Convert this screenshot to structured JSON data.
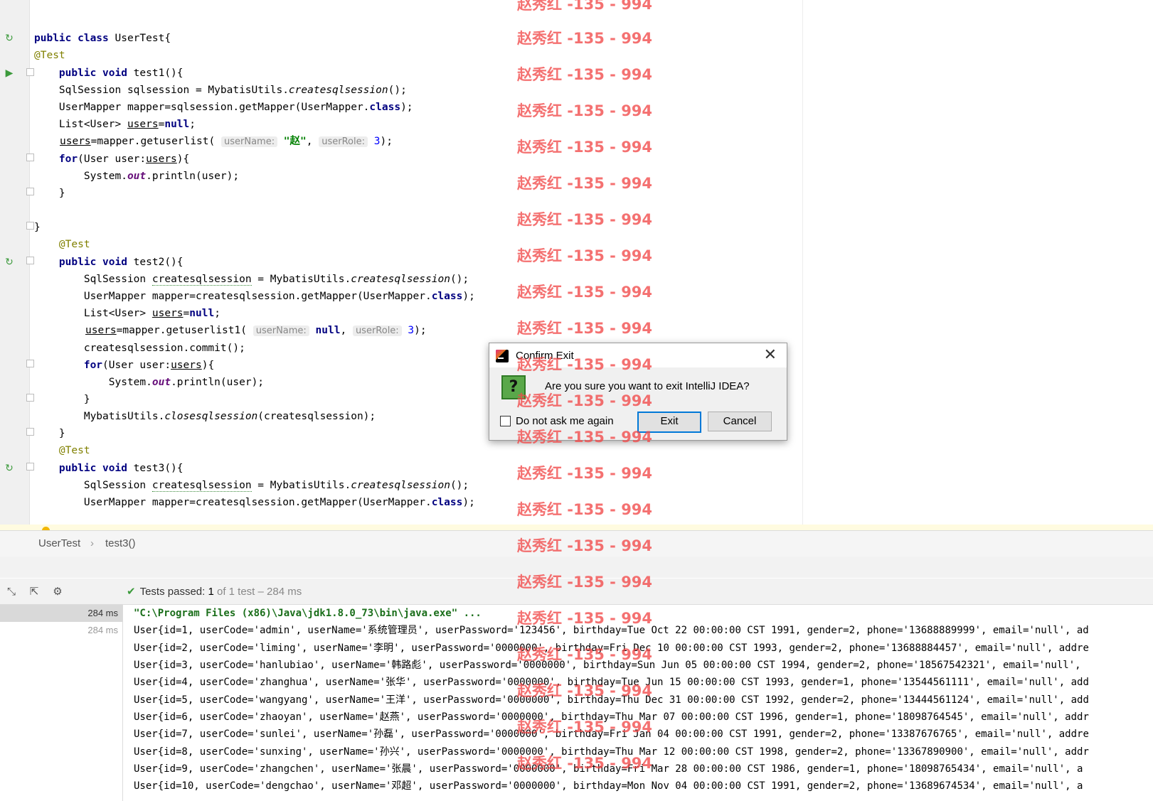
{
  "editor": {
    "lines": {
      "l1_a": "public class",
      "l1_b": " UserTest{",
      "l2": "@Test",
      "l3_a": "    public void",
      "l3_b": " test1(){",
      "l4_a": "    SqlSession sqlsession = MybatisUtils.",
      "l4_b": "createsqlsession",
      "l4_c": "();",
      "l5_a": "    UserMapper mapper=sqlsession.getMapper(UserMapper.",
      "l5_b": "class",
      "l5_c": ");",
      "l6_a": "    List<User> ",
      "l6_b": "users",
      "l6_c": "=",
      "l6_d": "null",
      "l6_e": ";",
      "l7_a": "users",
      "l7_b": "=mapper.getuserlist( ",
      "l7_hint1": "userName:",
      "l7_c": " \"赵\"",
      "l7_d": ", ",
      "l7_hint2": "userRole:",
      "l7_e": " 3",
      "l7_f": ");",
      "l8_a": "    for",
      "l8_b": "(User user:",
      "l8_c": "users",
      "l8_d": "){",
      "l9_a": "        System.",
      "l9_b": "out",
      "l9_c": ".println(user);",
      "l10": "    }",
      "l12": "}",
      "l13": "    @Test",
      "l14_a": "    public void",
      "l14_b": " test2(){",
      "l15_a": "        SqlSession ",
      "l15_b": "createsqlsession",
      "l15_c": " = MybatisUtils.",
      "l15_d": "createsqlsession",
      "l15_e": "();",
      "l16_a": "        UserMapper mapper=createsqlsession.getMapper(UserMapper.",
      "l16_b": "class",
      "l16_c": ");",
      "l17_a": "        List<User> ",
      "l17_b": "users",
      "l17_c": "=",
      "l17_d": "null",
      "l17_e": ";",
      "l18_a": "users",
      "l18_b": "=mapper.getuserlist1( ",
      "l18_hint1": "userName:",
      "l18_c": " null",
      "l18_d": ", ",
      "l18_hint2": "userRole:",
      "l18_e": " 3",
      "l18_f": ");",
      "l19": "        createsqlsession.commit();",
      "l20_a": "        for",
      "l20_b": "(User user:",
      "l20_c": "users",
      "l20_d": "){",
      "l21_a": "            System.",
      "l21_b": "out",
      "l21_c": ".println(user);",
      "l22": "        }",
      "l23_a": "        MybatisUtils.",
      "l23_b": "closesqlsession",
      "l23_c": "(createsqlsession);",
      "l24": "    }",
      "l25": "    @Test",
      "l26_a": "    public void",
      "l26_b": " test3(){",
      "l27_a": "        SqlSession ",
      "l27_b": "createsqlsession",
      "l27_c": " = MybatisUtils.",
      "l27_d": "createsqlsession",
      "l27_e": "();",
      "l28_a": "        UserMapper mapper=createsqlsession.getMapper(UserMapper.",
      "l28_b": "class",
      "l28_c": ");"
    }
  },
  "breadcrumb": {
    "items": [
      "UserTest",
      "test3()"
    ],
    "separator": "›"
  },
  "run_panel": {
    "status_prefix": "Tests passed:",
    "passed_count": "1",
    "status_suffix": "of 1 test – 284 ms",
    "tree": [
      {
        "time": "284 ms"
      },
      {
        "time": "284 ms"
      }
    ],
    "console": [
      "\"C:\\Program Files (x86)\\Java\\jdk1.8.0_73\\bin\\java.exe\" ...",
      "User{id=1, userCode='admin', userName='系统管理员', userPassword='123456', birthday=Tue Oct 22 00:00:00 CST 1991, gender=2, phone='13688889999', email='null', ad",
      "User{id=2, userCode='liming', userName='李明', userPassword='0000000', birthday=Fri Dec 10 00:00:00 CST 1993, gender=2, phone='13688884457', email='null', addre",
      "User{id=3, userCode='hanlubiao', userName='韩路彪', userPassword='0000000', birthday=Sun Jun 05 00:00:00 CST 1994, gender=2, phone='18567542321', email='null', ",
      "User{id=4, userCode='zhanghua', userName='张华', userPassword='0000000', birthday=Tue Jun 15 00:00:00 CST 1993, gender=1, phone='13544561111', email='null', add",
      "User{id=5, userCode='wangyang', userName='王洋', userPassword='0000000', birthday=Thu Dec 31 00:00:00 CST 1992, gender=2, phone='13444561124', email='null', add",
      "User{id=6, userCode='zhaoyan', userName='赵燕', userPassword='0000000', birthday=Thu Mar 07 00:00:00 CST 1996, gender=1, phone='18098764545', email='null', addr",
      "User{id=7, userCode='sunlei', userName='孙磊', userPassword='0000000', birthday=Fri Jan 04 00:00:00 CST 1991, gender=2, phone='13387676765', email='null', addre",
      "User{id=8, userCode='sunxing', userName='孙兴', userPassword='0000000', birthday=Thu Mar 12 00:00:00 CST 1998, gender=2, phone='13367890900', email='null', addr",
      "User{id=9, userCode='zhangchen', userName='张晨', userPassword='0000000', birthday=Fri Mar 28 00:00:00 CST 1986, gender=1, phone='18098765434', email='null', a",
      "User{id=10, userCode='dengchao', userName='邓超', userPassword='0000000', birthday=Mon Nov 04 00:00:00 CST 1991, gender=2, phone='13689674534', email='null', a"
    ]
  },
  "dialog": {
    "title": "Confirm Exit",
    "message": "Are you sure you want to exit IntelliJ IDEA?",
    "checkbox_label": "Do not ask me again",
    "exit_label": "Exit",
    "cancel_label": "Cancel",
    "icon": "question-icon"
  },
  "watermark": {
    "text": "赵秀红 -135 - 994"
  },
  "colors": {
    "keyword": "#000080",
    "annotation": "#808000",
    "string": "#008000",
    "watermark": "#f24a4a",
    "pass": "#3a9a3a"
  }
}
